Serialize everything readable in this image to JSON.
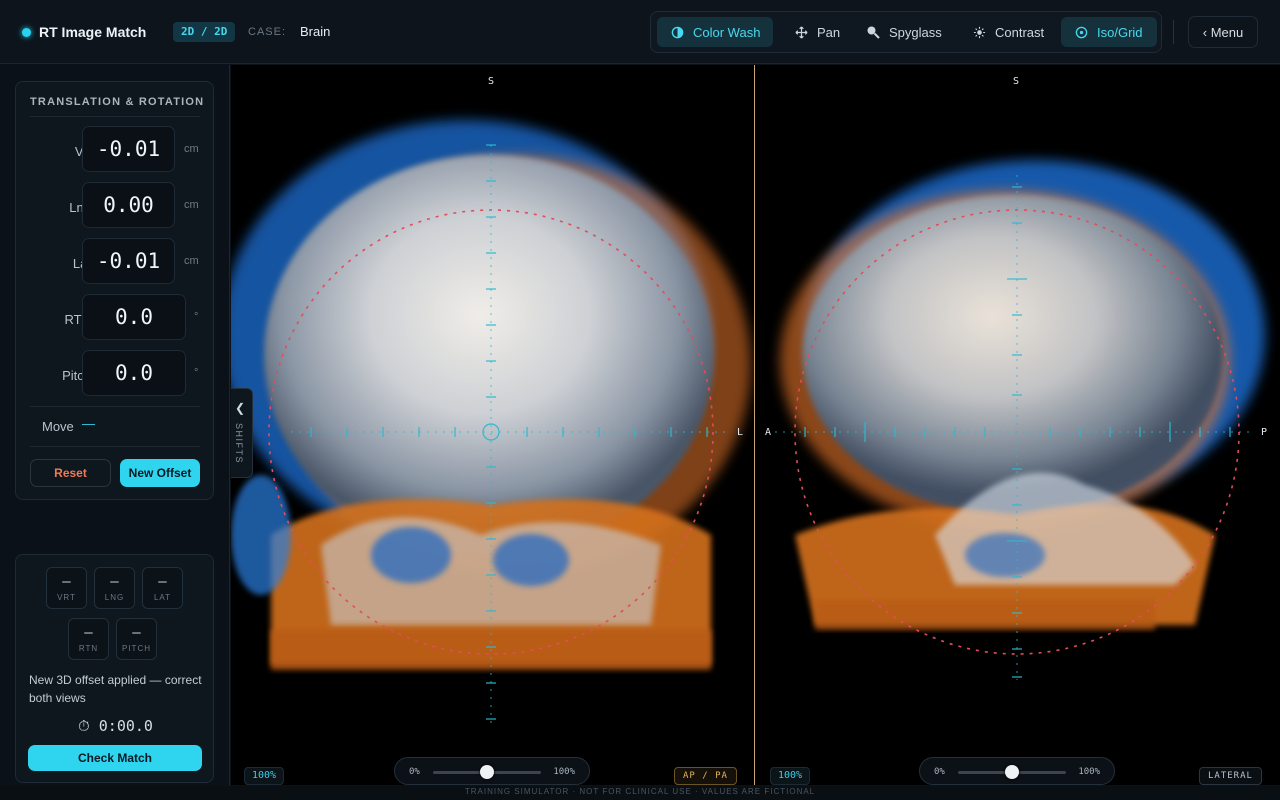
{
  "header": {
    "app_title": "RT Image Match",
    "mode": "2D / 2D",
    "case_label": "CASE:",
    "case_value": "Brain",
    "tools": [
      {
        "label": "Color Wash",
        "icon": "half-circle-icon",
        "active": true
      },
      {
        "label": "Pan",
        "icon": "move-icon",
        "active": false
      },
      {
        "label": "Spyglass",
        "icon": "magnifier-icon",
        "active": false
      },
      {
        "label": "Contrast",
        "icon": "sun-icon",
        "active": false
      },
      {
        "label": "Iso/Grid",
        "icon": "crosshair-icon",
        "active": true
      }
    ],
    "menu_label": "‹ Menu"
  },
  "shifts": {
    "title": "TRANSLATION & ROTATION",
    "rows": [
      {
        "label": "Vrt",
        "value": "-0.01",
        "unit": "cm"
      },
      {
        "label": "Lng",
        "value": "0.00",
        "unit": "cm"
      },
      {
        "label": "Lat",
        "value": "-0.01",
        "unit": "cm"
      },
      {
        "label": "RTN",
        "value": "0.0",
        "unit": "°"
      },
      {
        "label": "Pitch",
        "value": "0.0",
        "unit": "°"
      }
    ],
    "move_label": "Move",
    "move_value": "—",
    "reset_label": "Reset",
    "new_offset_label": "New Offset",
    "tab_label": "SHIFTS"
  },
  "check": {
    "chips": [
      {
        "value": "—",
        "name": "VRT"
      },
      {
        "value": "—",
        "name": "LNG"
      },
      {
        "value": "—",
        "name": "LAT"
      },
      {
        "value": "—",
        "name": "RTN"
      },
      {
        "value": "—",
        "name": "PITCH"
      }
    ],
    "status": "New 3D offset applied — correct both views",
    "timer": "⏱ 0:00.0",
    "check_label": "Check Match"
  },
  "viewer_ap": {
    "orient_top": "S",
    "orient_right": "L",
    "zoom": "100%",
    "blend_low": "0%",
    "blend_high": "100%",
    "blend_percent": 50,
    "view_name": "AP / PA"
  },
  "viewer_lat": {
    "orient_top": "S",
    "orient_left": "A",
    "orient_right": "P",
    "zoom": "100%",
    "blend_low": "0%",
    "blend_high": "100%",
    "blend_percent": 50,
    "view_name": "LATERAL"
  },
  "footer": "TRAINING SIMULATOR · NOT FOR CLINICAL USE · VALUES ARE FICTIONAL",
  "colors": {
    "accent": "#2fd4ee",
    "drr_overlay": "#ff8a2a",
    "kv_image": "#2e7fe0",
    "reset": "#ee7a55",
    "isocenter_circle": "#e24d5a"
  }
}
